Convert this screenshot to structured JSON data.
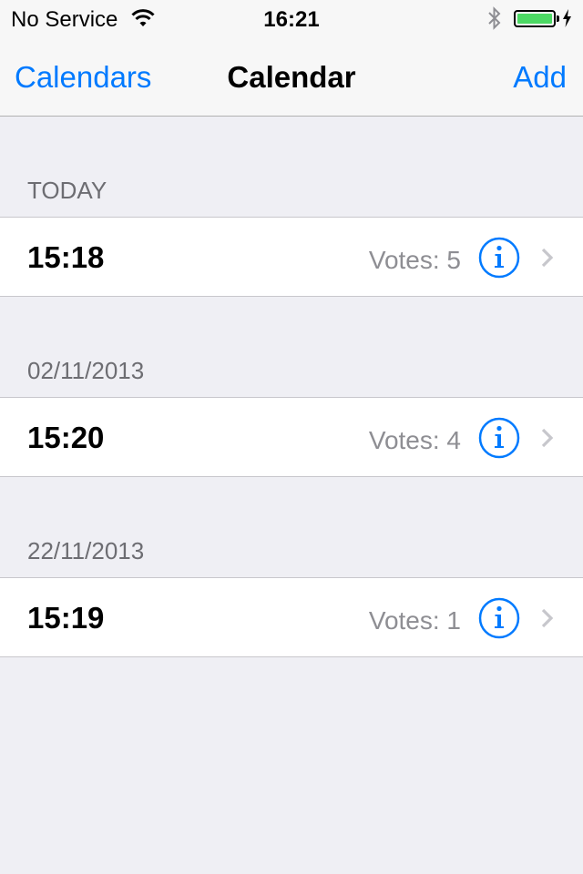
{
  "status_bar": {
    "carrier": "No Service",
    "time": "16:21",
    "icons": [
      "wifi-icon",
      "bluetooth-icon",
      "battery-icon",
      "charging-bolt-icon"
    ],
    "battery_level": 1.0,
    "battery_color": "#4cd964"
  },
  "navbar": {
    "back_label": "Calendars",
    "title": "Calendar",
    "add_label": "Add",
    "tint_color": "#007aff"
  },
  "sections": [
    {
      "header": "TODAY",
      "row": {
        "time": "15:18",
        "votes": "Votes: 5"
      }
    },
    {
      "header": "02/11/2013",
      "row": {
        "time": "15:20",
        "votes": "Votes: 4"
      }
    },
    {
      "header": "22/11/2013",
      "row": {
        "time": "15:19",
        "votes": "Votes: 1"
      }
    }
  ]
}
